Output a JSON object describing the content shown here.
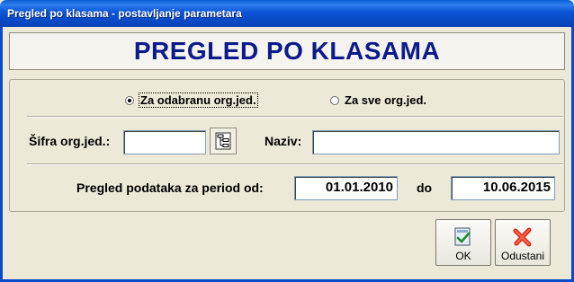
{
  "window": {
    "title": "Pregled po klasama - postavljanje parametara"
  },
  "header": {
    "heading": "PREGLED PO KLASAMA"
  },
  "scope": {
    "option_selected": "Za odabranu org.jed.",
    "option_all": "Za sve org.jed."
  },
  "org": {
    "code_label": "Šifra org.jed.:",
    "code_value": "",
    "tree_button_icon": "tree-hierarchy-icon",
    "name_label": "Naziv:",
    "name_value": ""
  },
  "period": {
    "label": "Pregled podataka za period od:",
    "from_value": "01.01.2010",
    "to_label": "do",
    "to_value": "10.06.2015"
  },
  "buttons": {
    "ok_label": "OK",
    "ok_icon": "checkmark-document-icon",
    "cancel_label": "Odustani",
    "cancel_icon": "red-x-icon"
  },
  "colors": {
    "titlebar": "#0a4ac6",
    "heading_text": "#0c1a8c",
    "window_bg": "#ece9d8"
  }
}
